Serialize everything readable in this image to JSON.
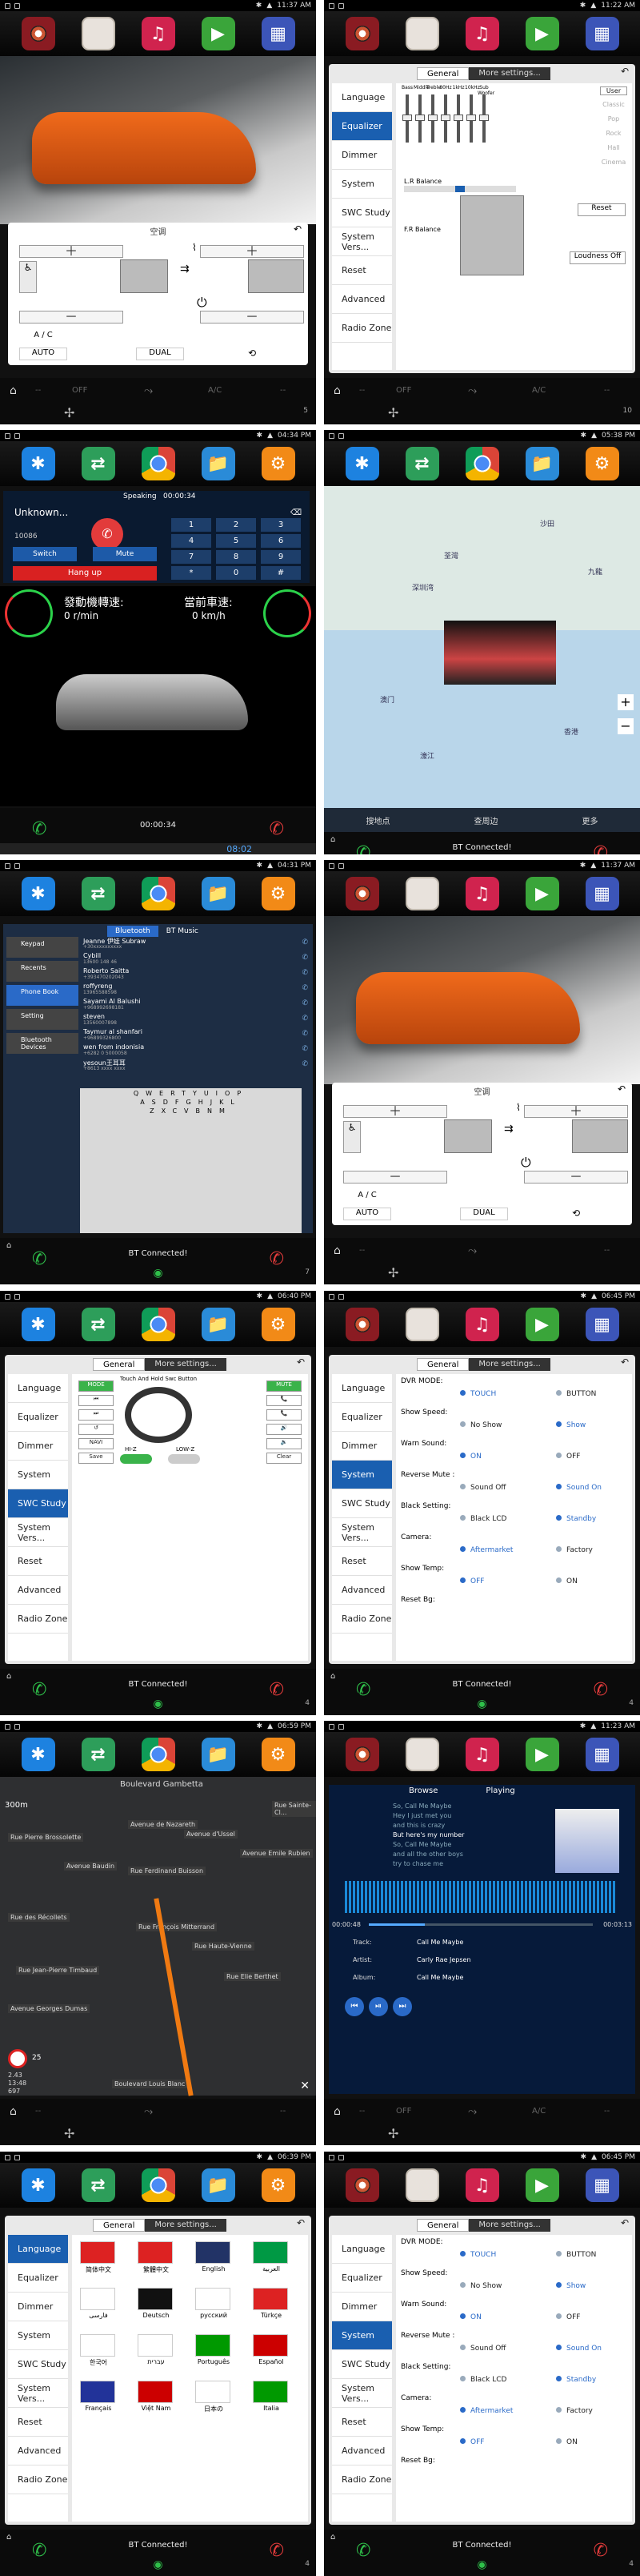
{
  "panels": [
    {
      "time": "11:37 AM",
      "count": "5",
      "ac": {
        "title": "空调",
        "auto": "AUTO",
        "dual": "DUAL",
        "ac": "A / C"
      },
      "bottom": {
        "off": "OFF",
        "ac": "A/C"
      }
    },
    {
      "time": "11:22 AM",
      "count": "10",
      "eq": {
        "tabs": [
          "General",
          "More settings..."
        ],
        "menu": [
          "Language",
          "Equalizer",
          "Dimmer",
          "System",
          "SWC Study",
          "System Vers...",
          "Reset",
          "Advanced",
          "Radio Zone"
        ],
        "sliders": [
          "Bass",
          "Middle",
          "Treble",
          "80Hz",
          "1kHz",
          "10kHz",
          "Sub Woofer"
        ],
        "presets": [
          "User",
          "Classic",
          "Pop",
          "Rock",
          "Hall",
          "Cinema"
        ],
        "lr": "L.R Balance",
        "fr": "F.R Balance",
        "reset": "Reset",
        "loud": "Loudness Off"
      },
      "bottom": {
        "off": "OFF",
        "ac": "A/C"
      }
    },
    {
      "time": "04:34 PM",
      "phone": {
        "speaking": "Speaking",
        "dur": "00:00:34",
        "name": "Unknown...",
        "num": "10086",
        "keys": [
          "1",
          "2",
          "3",
          "4",
          "5",
          "6",
          "7",
          "8",
          "9",
          "*",
          "0",
          "#"
        ],
        "switch": "Switch",
        "mute": "Mute",
        "hang": "Hang up"
      },
      "gauge": {
        "rpm_label": "發動機轉速:",
        "rpm": "0 r/min",
        "speed_label": "當前車速:",
        "speed": "0 km/h"
      },
      "bottom": {
        "time": "00:00:34",
        "clock": "08:02"
      }
    },
    {
      "time": "05:38 PM",
      "map": {
        "labels": [
          "沙田",
          "荃灣",
          "九龍",
          "深圳湾",
          "澳门",
          "香港",
          "濠江"
        ],
        "b1": "搜地点",
        "b2": "查周边",
        "b3": "更多"
      },
      "bottom": {
        "bt": "BT Connected!",
        "count": "2"
      }
    },
    {
      "time": "04:31 PM",
      "bt": {
        "tabs": [
          "Bluetooth",
          "BT Music"
        ],
        "menu": [
          "Keypad",
          "Recents",
          "Phone Book",
          "Setting",
          "Bluetooth Devices"
        ],
        "contacts": [
          {
            "n": "Jeanne 伊娃 Subraw",
            "p": "+30xxxxxxxxxx"
          },
          {
            "n": "Cybill",
            "p": "13600 148 46"
          },
          {
            "n": "Roberto Saitta",
            "p": "+393470202043"
          },
          {
            "n": "roffyreng",
            "p": "13965588598"
          },
          {
            "n": "Sayami Al Balushi",
            "p": "+968992698181"
          },
          {
            "n": "steven",
            "p": "13560007898"
          },
          {
            "n": "Taymur al shanfari",
            "p": "+96899326800"
          },
          {
            "n": "wen from indonisia",
            "p": "+6282 0 5000058"
          },
          {
            "n": "yesoun王耳耳",
            "p": "+8613 xxxx xxxx"
          }
        ],
        "kb": [
          "QWERTYUIOP",
          "ASDFGHJKL",
          "ZXCVBNM"
        ]
      },
      "bottom": {
        "bt": "BT Connected!",
        "count": "7"
      }
    },
    {
      "time": "11:37 AM",
      "ac": {
        "title": "空调",
        "auto": "AUTO",
        "dual": "DUAL",
        "ac": "A / C"
      },
      "bottom": {
        "count": "9"
      }
    },
    {
      "time": "06:40 PM",
      "swc": {
        "tabs": [
          "General",
          "More settings..."
        ],
        "menu": [
          "Language",
          "Equalizer",
          "Dimmer",
          "System",
          "SWC Study",
          "System Vers...",
          "Reset",
          "Advanced",
          "Radio Zone"
        ],
        "hint": "Touch And Hold Swc Button",
        "left": [
          "MODE",
          "⏮",
          "⏭",
          "↺",
          "NAVI",
          "Save"
        ],
        "right": [
          "MUTE",
          "📞",
          "📞",
          "🔊",
          "🔉",
          "Clear"
        ],
        "hiz": "HI-Z",
        "lowz": "LOW-Z"
      },
      "bottom": {
        "bt": "BT Connected!",
        "count": "4"
      }
    },
    {
      "time": "06:45 PM",
      "dvr": {
        "tabs": [
          "General",
          "More settings..."
        ],
        "menu": [
          "Language",
          "Equalizer",
          "Dimmer",
          "System",
          "SWC Study",
          "System Vers...",
          "Reset",
          "Advanced",
          "Radio Zone"
        ],
        "rows": [
          {
            "l": "DVR MODE:",
            "a": "TOUCH",
            "b": "BUTTON",
            "on": "a"
          },
          {
            "l": "Show Speed:",
            "a": "No Show",
            "b": "Show",
            "on": "b"
          },
          {
            "l": "Warn Sound:",
            "a": "ON",
            "b": "OFF",
            "on": "a"
          },
          {
            "l": "Reverse Mute :",
            "a": "Sound Off",
            "b": "Sound On",
            "on": "b"
          },
          {
            "l": "Black Setting:",
            "a": "Black LCD",
            "b": "Standby",
            "on": "b"
          },
          {
            "l": "Camera:",
            "a": "Aftermarket",
            "b": "Factory",
            "on": "a"
          },
          {
            "l": "Show Temp:",
            "a": "OFF",
            "b": "ON",
            "on": "a"
          },
          {
            "l": "Reset Bg:",
            "a": "",
            "b": "",
            "on": ""
          }
        ]
      },
      "bottom": {
        "bt": "BT Connected!",
        "count": "4"
      }
    },
    {
      "time": "06:59 PM",
      "nav": {
        "top": "Boulevard Gambetta",
        "dist": "300m",
        "streets": [
          "Rue Pierre Brossolette",
          "Avenue de Nazareth",
          "Avenue Baudin",
          "Rue Ferdinand Buisson",
          "Rue des Récollets",
          "Rue François Mitterrand",
          "Rue Jean-Pierre Timbaud",
          "Avenue Georges Dumas",
          "Rue Haute-Vienne",
          "Rue Elie Berthet",
          "Boulevard Louis Blanc",
          "Rue Sainte-Cl...",
          "Avenue d'Ussel",
          "Avenue Emile Rubien"
        ],
        "speed": "25",
        "eta": [
          "2.43",
          "13:48",
          "697"
        ]
      },
      "bottom": {}
    },
    {
      "time": "11:23 AM",
      "music": {
        "tabs": [
          "Browse",
          "Playing"
        ],
        "lyrics": [
          "So, Call Me Maybe",
          "Hey I just met you",
          "and this is crazy",
          "But here's my number",
          "So, Call Me Maybe",
          "and all the other boys",
          "try to chase me"
        ],
        "elapsed": "00:00:48",
        "total": "00:03:13",
        "track_l": "Track:",
        "track": "Call Me Maybe",
        "artist_l": "Artist:",
        "artist": "Carly Rae Jepsen",
        "album_l": "Album:",
        "album": "Call Me Maybe"
      },
      "bottom": {
        "off": "OFF",
        "ac": "A/C",
        "count": "12"
      }
    },
    {
      "time": "06:39 PM",
      "lang": {
        "tabs": [
          "General",
          "More settings..."
        ],
        "menu": [
          "Language",
          "Equalizer",
          "Dimmer",
          "System",
          "SWC Study",
          "System Vers...",
          "Reset",
          "Advanced",
          "Radio Zone"
        ],
        "langs": [
          "简体中文",
          "繁體中文",
          "English",
          "العربية",
          "فارسی",
          "Deutsch",
          "русский",
          "Türkçe",
          "한국어",
          "עברית",
          "Português",
          "Español",
          "Français",
          "Việt Nam",
          "日本の",
          "Italia"
        ]
      },
      "bottom": {
        "bt": "BT Connected!",
        "count": "4"
      }
    },
    {
      "time": "06:45 PM",
      "dvr": {
        "tabs": [
          "General",
          "More settings..."
        ],
        "menu": [
          "Language",
          "Equalizer",
          "Dimmer",
          "System",
          "SWC Study",
          "System Vers...",
          "Reset",
          "Advanced",
          "Radio Zone"
        ],
        "rows": [
          {
            "l": "DVR MODE:",
            "a": "TOUCH",
            "b": "BUTTON",
            "on": "a"
          },
          {
            "l": "Show Speed:",
            "a": "No Show",
            "b": "Show",
            "on": "b"
          },
          {
            "l": "Warn Sound:",
            "a": "ON",
            "b": "OFF",
            "on": "a"
          },
          {
            "l": "Reverse Mute :",
            "a": "Sound Off",
            "b": "Sound On",
            "on": "b"
          },
          {
            "l": "Black Setting:",
            "a": "Black LCD",
            "b": "Standby",
            "on": "b"
          },
          {
            "l": "Camera:",
            "a": "Aftermarket",
            "b": "Factory",
            "on": "a"
          },
          {
            "l": "Show Temp:",
            "a": "OFF",
            "b": "ON",
            "on": "a"
          },
          {
            "l": "Reset Bg:",
            "a": "",
            "b": "",
            "on": ""
          }
        ]
      },
      "bottom": {
        "bt": "BT Connected!",
        "count": "4"
      }
    }
  ],
  "colors": {
    "accent": "#1a5fb0",
    "green": "#2fc04a",
    "red": "#e23b3b"
  }
}
